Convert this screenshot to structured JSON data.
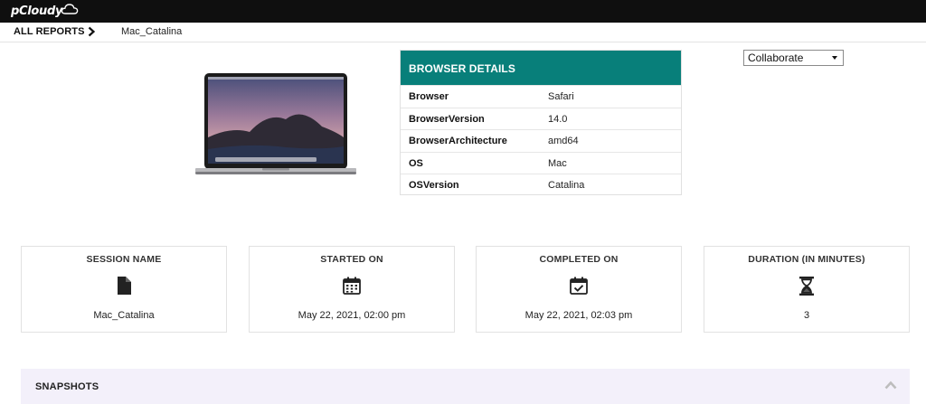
{
  "app": {
    "logo_text": "pCloudy"
  },
  "breadcrumb": {
    "root": "ALL REPORTS",
    "current": "Mac_Catalina"
  },
  "browser_details": {
    "title": "BROWSER DETAILS",
    "rows": [
      {
        "key": "Browser",
        "value": "Safari"
      },
      {
        "key": "BrowserVersion",
        "value": "14.0"
      },
      {
        "key": "BrowserArchitecture",
        "value": "amd64"
      },
      {
        "key": "OS",
        "value": "Mac"
      },
      {
        "key": "OSVersion",
        "value": "Catalina"
      }
    ]
  },
  "collaborate": {
    "selected": "Collaborate"
  },
  "cards": [
    {
      "title": "SESSION NAME",
      "icon": "file-icon",
      "value": "Mac_Catalina"
    },
    {
      "title": "STARTED ON",
      "icon": "calendar-icon",
      "value": "May 22, 2021, 02:00 pm"
    },
    {
      "title": "COMPLETED ON",
      "icon": "calendar-check-icon",
      "value": "May 22, 2021, 02:03 pm"
    },
    {
      "title": "DURATION (IN MINUTES)",
      "icon": "hourglass-icon",
      "value": "3"
    }
  ],
  "snapshots": {
    "title": "SNAPSHOTS"
  },
  "colors": {
    "topbar": "#0f0f0f",
    "accent": "#087f7a",
    "snapshots_bg": "#f3f0fa"
  }
}
